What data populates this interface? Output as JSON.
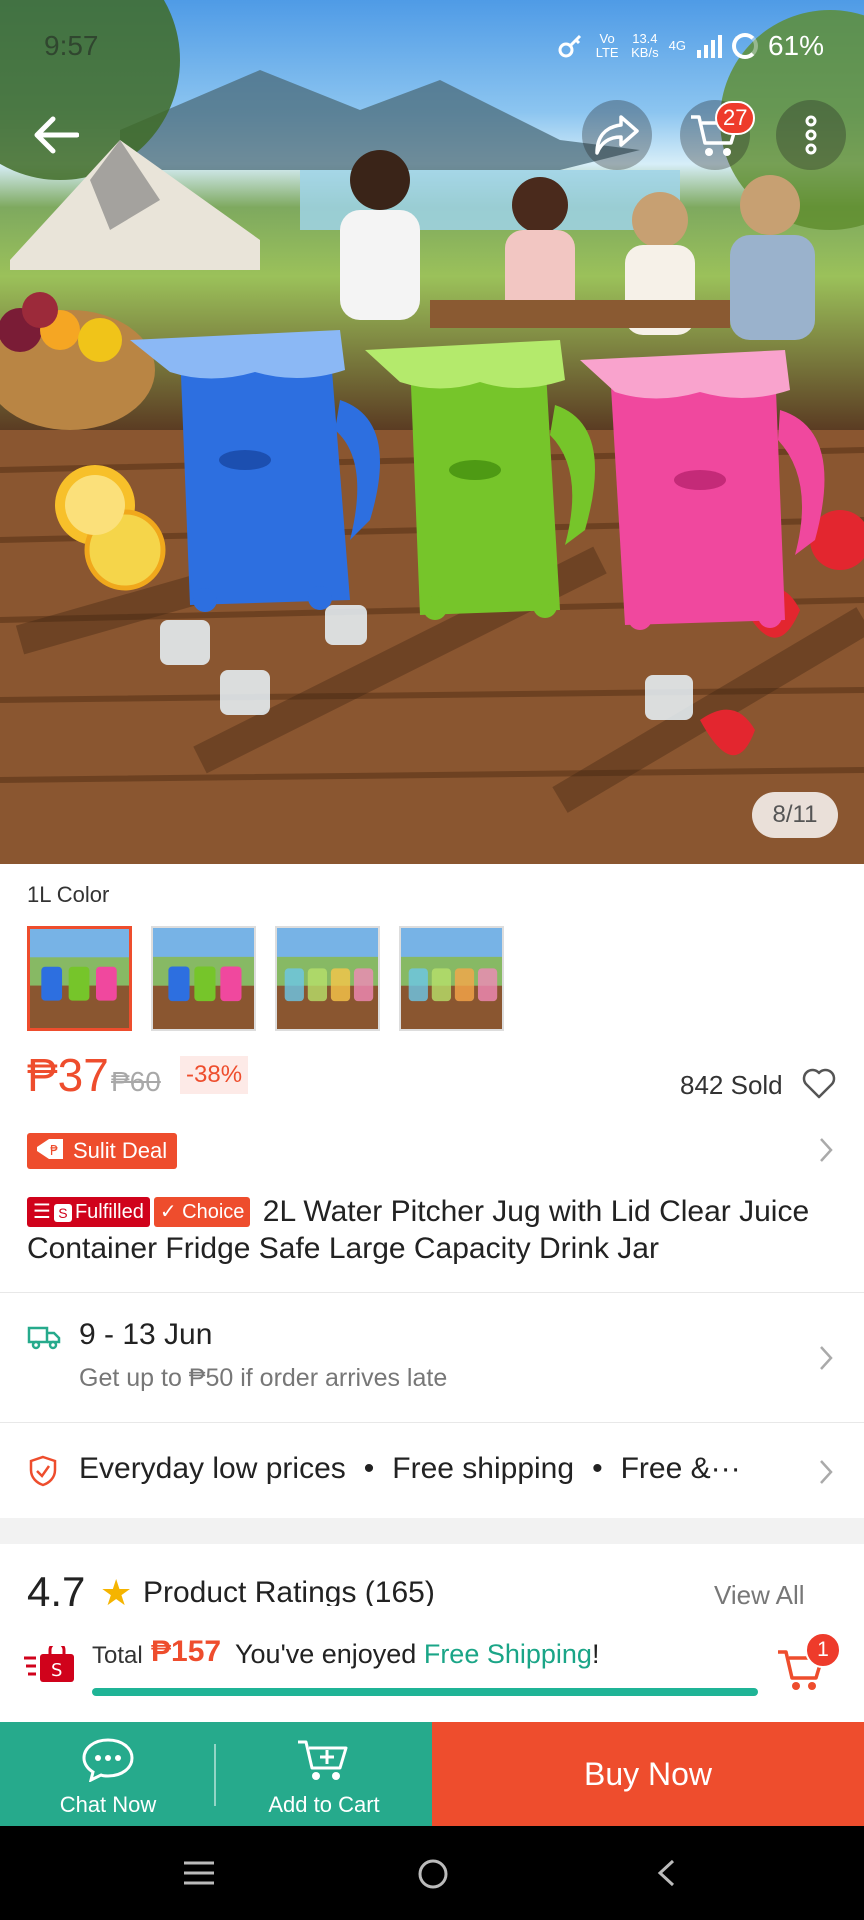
{
  "status_bar": {
    "time": "9:57",
    "net_speed": "13.4",
    "net_unit": "KB/s",
    "network_type": "4G",
    "volte": "Vo LTE",
    "battery": "61%"
  },
  "header": {
    "cart_count": "27",
    "image_counter": "8/11",
    "icons": [
      "back-arrow-icon",
      "share-icon",
      "cart-icon",
      "more-vertical-icon"
    ]
  },
  "variants": {
    "label": "1L Color",
    "count": 4,
    "selected_index": 0
  },
  "price": {
    "current": "₱37",
    "original": "₱60",
    "discount": "-38%",
    "sold": "842 Sold"
  },
  "promo": {
    "sulit_label": "Sulit Deal"
  },
  "product": {
    "badge_fulfilled": "Fulfilled",
    "badge_choice": "✓ Choice",
    "title": "2L Water Pitcher Jug with Lid Clear Juice Container Fridge Safe Large Capacity Drink Jar"
  },
  "shipping": {
    "date_range": "9 - 13 Jun",
    "late_note": "Get up to ₱50 if order arrives late"
  },
  "guarantee": {
    "items": [
      "Everyday low prices",
      "Free shipping",
      "Free &···"
    ]
  },
  "ratings": {
    "value": "4.7",
    "title": "Product Ratings (165)",
    "view_all": "View All"
  },
  "cart_summary": {
    "total_label": "Total",
    "total": "₱157",
    "msg_prefix": "You've enjoyed ",
    "msg_highlight": "Free Shipping",
    "msg_suffix": "!",
    "cart_count": "1"
  },
  "actions": {
    "chat_now": "Chat Now",
    "add_to_cart": "Add to Cart",
    "buy_now": "Buy Now"
  },
  "colors": {
    "accent": "#ee4d2d",
    "teal": "#26aa8c",
    "progress": "#1fb496"
  }
}
